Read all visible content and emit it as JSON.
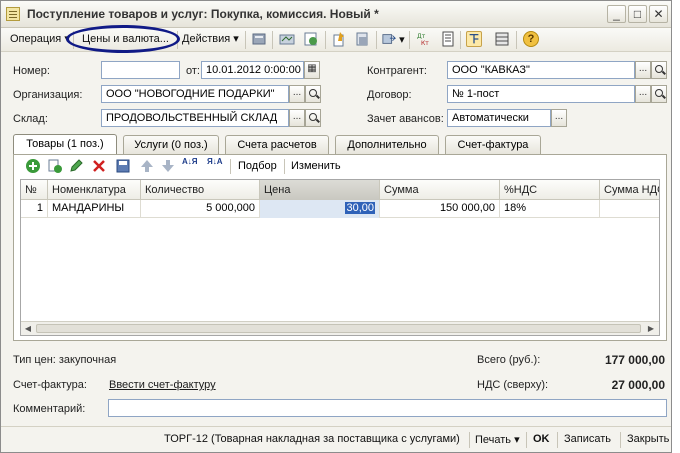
{
  "window": {
    "title": "Поступление товаров и услуг: Покупка, комиссия. Новый *",
    "min_label": "_",
    "max_label": "□",
    "close_label": "✕"
  },
  "toolbar": {
    "operation_label": "Операция",
    "prices_label": "Цены и валюта...",
    "actions_label": "Действия",
    "dropdown_arrow": "▾",
    "help_label": "?"
  },
  "form": {
    "number_label": "Номер:",
    "number_value": "",
    "from_label": "от:",
    "date_value": "10.01.2012  0:00:00",
    "org_label": "Организация:",
    "org_value": "ООО \"НОВОГОДНИЕ ПОДАРКИ\"",
    "warehouse_label": "Склад:",
    "warehouse_value": "ПРОДОВОЛЬСТВЕННЫЙ СКЛАД",
    "counterparty_label": "Контрагент:",
    "counterparty_value": "ООО \"КАВКАЗ\"",
    "contract_label": "Договор:",
    "contract_value": "№ 1-пост",
    "advance_label": "Зачет авансов:",
    "advance_value": "Автоматически",
    "select_btn": "...",
    "date_icon": "▦"
  },
  "tabs": [
    {
      "label": "Товары (1 поз.)"
    },
    {
      "label": "Услуги (0 поз.)"
    },
    {
      "label": "Счета расчетов"
    },
    {
      "label": "Дополнительно"
    },
    {
      "label": "Счет-фактура"
    }
  ],
  "subtoolbar": {
    "selection_label": "Подбор",
    "edit_label": "Изменить",
    "sort_asc_label": "А↓Я",
    "sort_desc_label": "Я↓А"
  },
  "table": {
    "columns": [
      "№",
      "Номенклатура",
      "Количество",
      "Цена",
      "Сумма",
      "%НДС",
      "Сумма НДС"
    ],
    "rows": [
      {
        "n": "1",
        "item": "МАНДАРИНЫ",
        "qty": "5 000,000",
        "price": "30,00",
        "sum": "150 000,00",
        "vat": "18%",
        "vat_sum": ""
      }
    ]
  },
  "footer": {
    "price_type_label": "Тип цен: закупочная",
    "total_label": "Всего (руб.):",
    "total_value": "177 000,00",
    "invoice_label": "Счет-фактура:",
    "invoice_link": "Ввести счет-фактуру",
    "vat_label": "НДС (сверху):",
    "vat_value": "27 000,00",
    "comment_label": "Комментарий:",
    "comment_value": ""
  },
  "bottombar": {
    "torg_label": "ТОРГ-12 (Товарная накладная за поставщика с услугами)",
    "print_label": "Печать",
    "ok_label": "OK",
    "save_label": "Записать",
    "close_label": "Закрыть",
    "dropdown_arrow": "▾"
  },
  "colors": {
    "accent_circle": "#101a86",
    "selection": "#2f62b8",
    "field_border": "#8fa5c4"
  }
}
